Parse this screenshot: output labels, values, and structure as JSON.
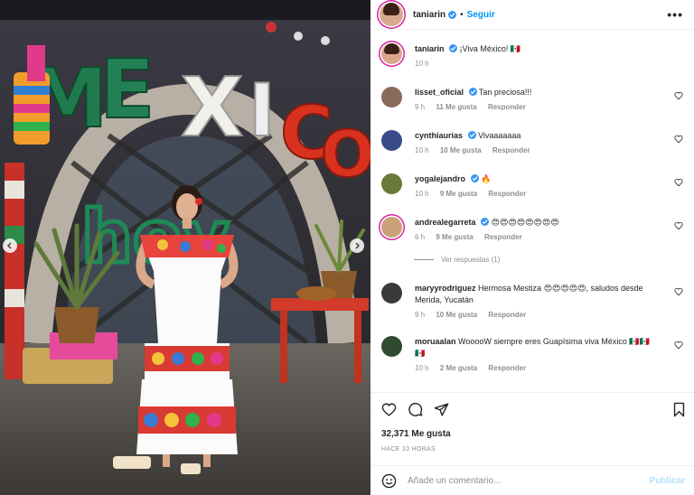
{
  "post": {
    "username": "taniarin",
    "follow_label": "Seguir",
    "separator": "•",
    "more_label": "•••",
    "caption": "¡Viva México! 🇲🇽",
    "caption_time": "10 h"
  },
  "comments": [
    {
      "user": "lisset_oficial",
      "verified": true,
      "text": "Tan preciosa!!!",
      "time": "9 h",
      "likes": "11 Me gusta",
      "reply": "Responder",
      "avatar_color": "#8a6a5a"
    },
    {
      "user": "cynthiaurias",
      "verified": true,
      "text": "Vivaaaaaaa",
      "time": "10 h",
      "likes": "10 Me gusta",
      "reply": "Responder",
      "avatar_color": "#3a4a8a"
    },
    {
      "user": "yogalejandro",
      "verified": true,
      "text": "🔥",
      "time": "10 h",
      "likes": "9 Me gusta",
      "reply": "Responder",
      "avatar_color": "#6a7a3a"
    },
    {
      "user": "andrealegarreta",
      "verified": true,
      "text": "😍😍😍😍😍😍😍😍",
      "time": "6 h",
      "likes": "9 Me gusta",
      "reply": "Responder",
      "avatar_color": "#c9a27a"
    },
    {
      "user": "maryyrodriguez",
      "verified": false,
      "text": "Hermosa Mestiza 😍😍😍😍😍, saludos desde Merida, Yucatán",
      "time": "9 h",
      "likes": "10 Me gusta",
      "reply": "Responder",
      "avatar_color": "#3a3a3a"
    },
    {
      "user": "moruaalan",
      "verified": false,
      "text": "WooooW siempre eres Guapísima viva México 🇲🇽🇲🇽🇲🇽",
      "time": "10 h",
      "likes": "2 Me gusta",
      "reply": "Responder",
      "avatar_color": "#2f4a2f"
    }
  ],
  "view_replies": "Ver respuestas (1)",
  "likes_total": "32,371 Me gusta",
  "posted_ago": "HACE 10 HORAS",
  "comment_placeholder": "Añade un comentario...",
  "publish_label": "Publicar",
  "icons": [
    "heart-icon",
    "comment-icon",
    "share-icon",
    "bookmark-icon",
    "emoji-icon",
    "verified-icon",
    "more-icon"
  ],
  "colors": {
    "link_blue": "#0095f6",
    "verified_blue": "#3897f0",
    "muted": "#8e8e8e",
    "publish_disabled": "#b2dffc"
  }
}
